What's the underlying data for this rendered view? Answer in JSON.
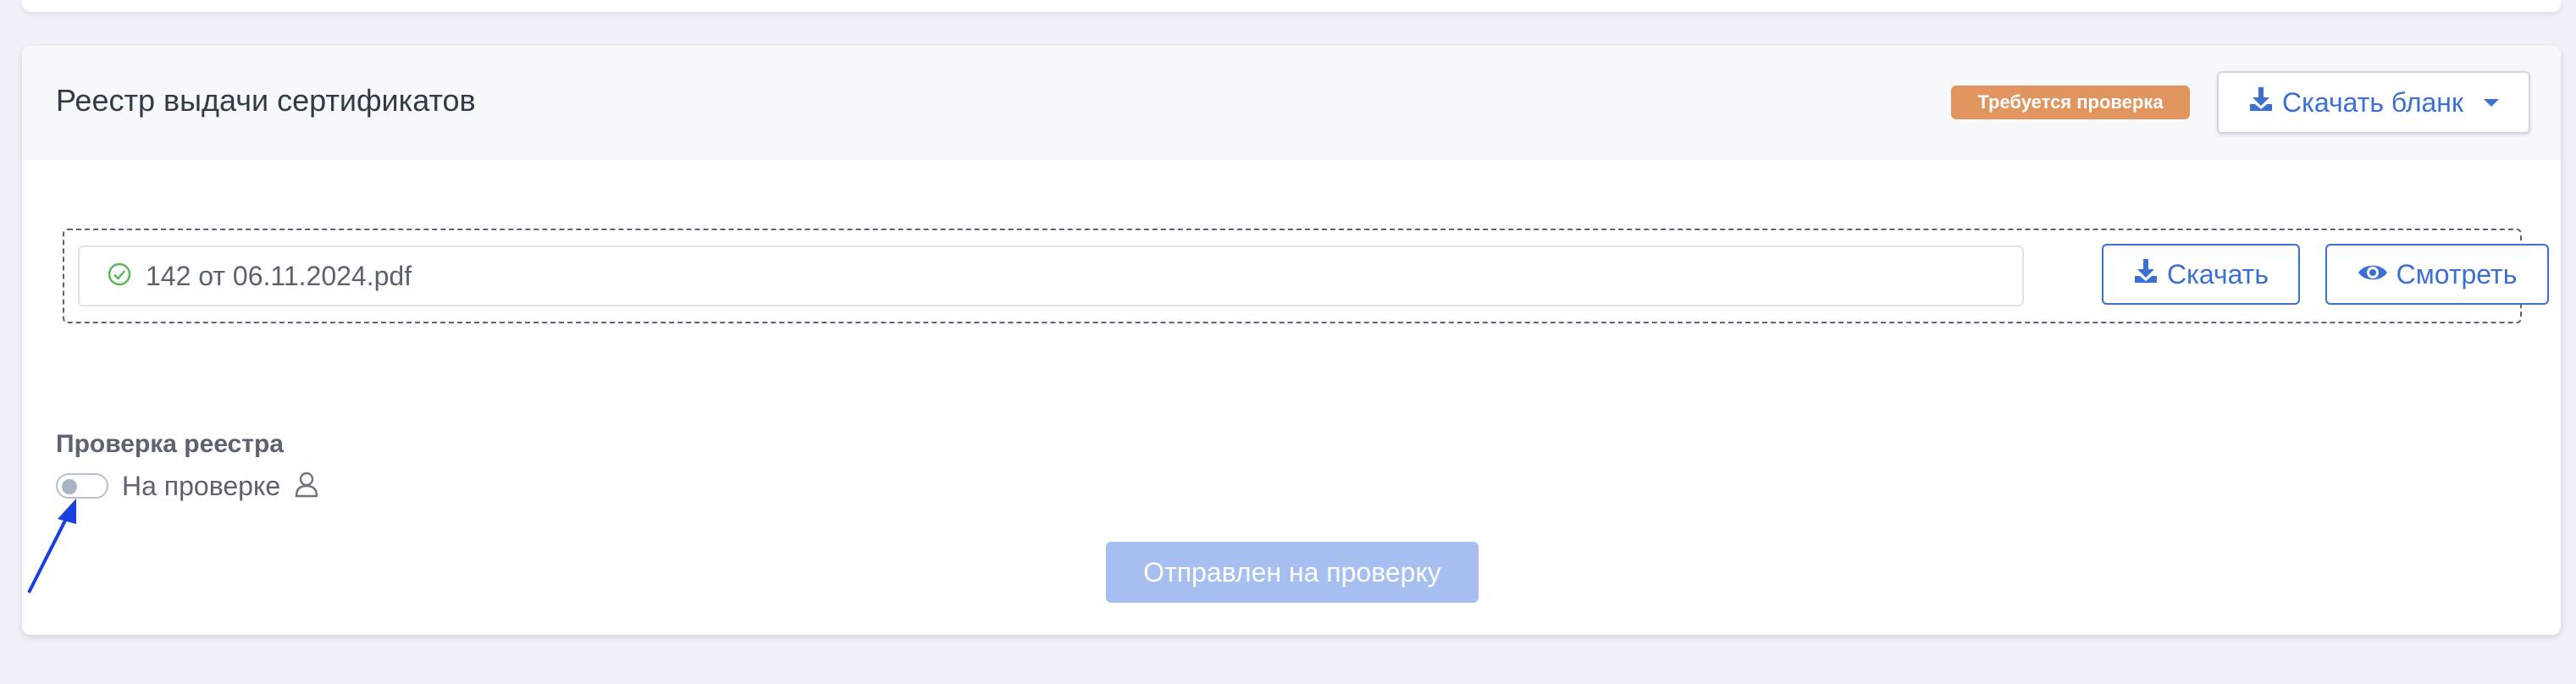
{
  "card": {
    "title": "Реестр выдачи сертификатов",
    "badge": "Требуется проверка",
    "download_blank_label": "Скачать бланк"
  },
  "file": {
    "name": "142 от 06.11.2024.pdf",
    "download_label": "Скачать",
    "view_label": "Смотреть"
  },
  "review": {
    "section_label": "Проверка реестра",
    "toggle_label": "На проверке",
    "toggle_on": false,
    "submit_label": "Отправлен на проверку"
  },
  "colors": {
    "accent": "#3b6fd3",
    "badge": "#e0955e",
    "submit_disabled": "#a7bff0",
    "annotation_arrow": "#1a3fe0"
  }
}
